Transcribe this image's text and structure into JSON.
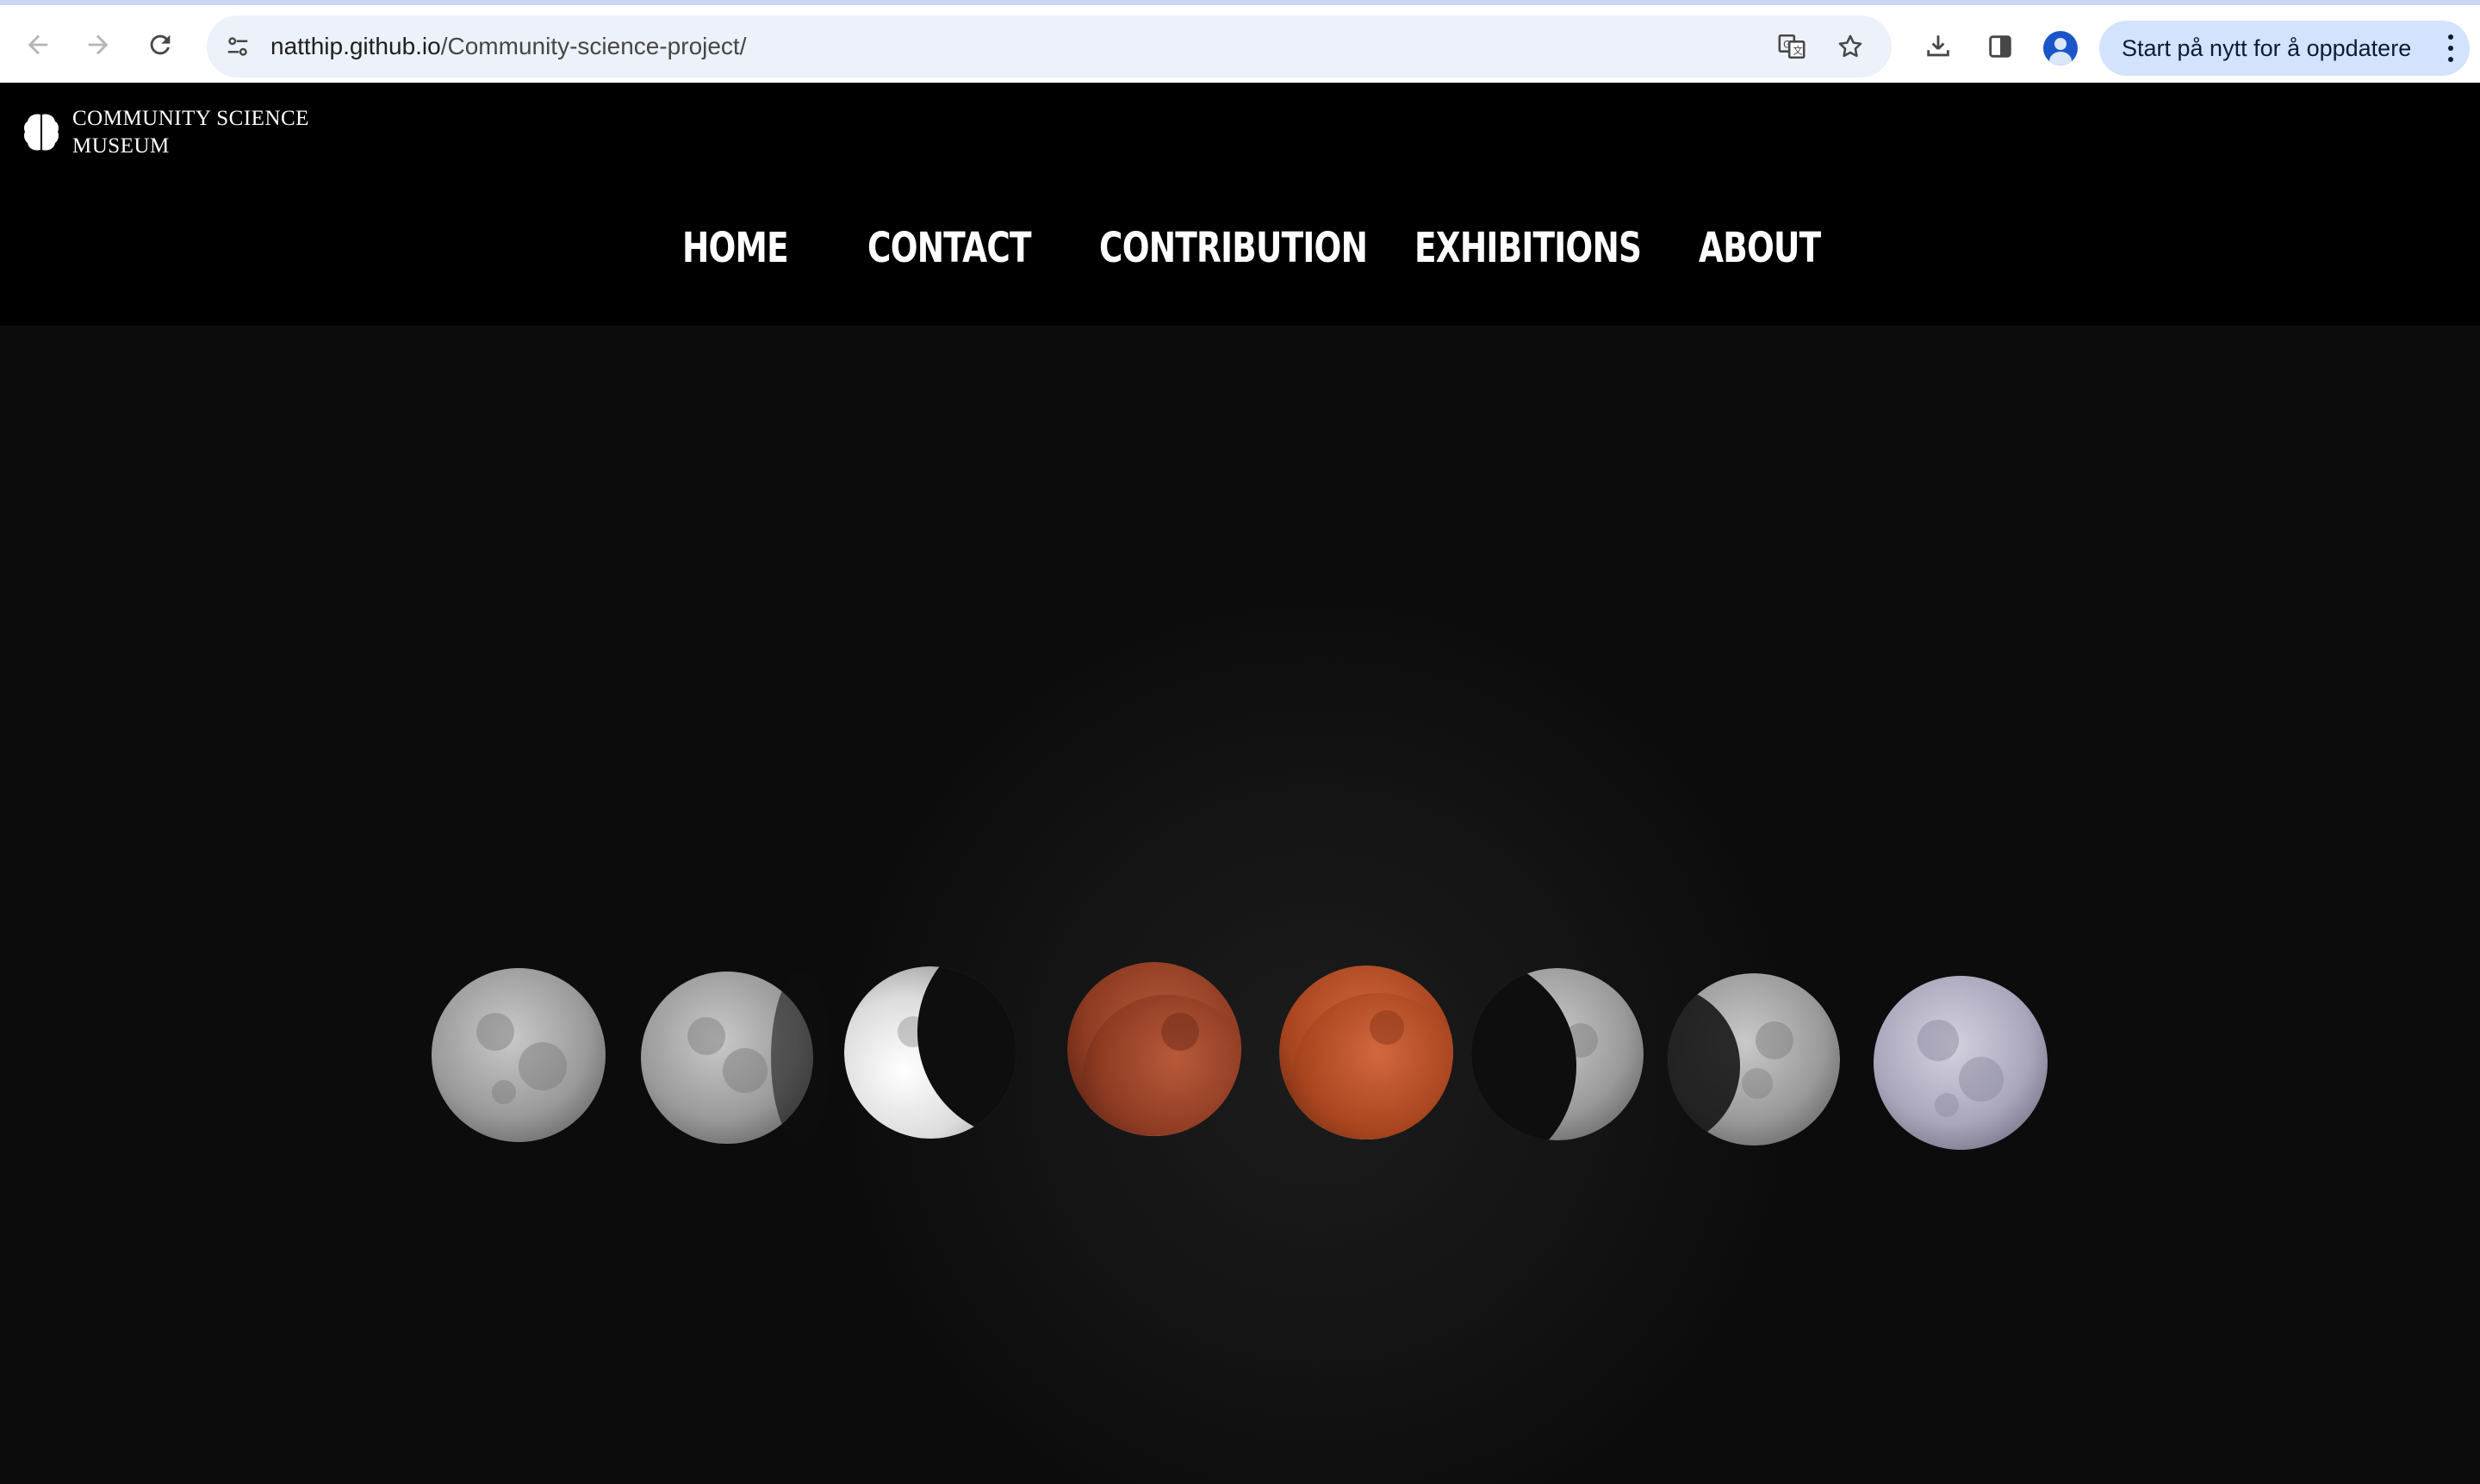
{
  "browser": {
    "url_host": "natthip.github.io",
    "url_path": "/Community-science-project/",
    "update_button_label": "Start på nytt for å oppdatere",
    "icons": [
      "back-icon",
      "forward-icon",
      "reload-icon",
      "site-info-icon",
      "translate-icon",
      "bookmark-star-icon",
      "download-icon",
      "side-panel-icon",
      "profile-avatar-icon",
      "more-menu-icon"
    ]
  },
  "site": {
    "logo_line1": "COMMUNITY SCIENCE",
    "logo_line2": "MUSEUM",
    "logo_icon": "brain-icon",
    "nav": [
      {
        "label": "HOME"
      },
      {
        "label": "CONTACT"
      },
      {
        "label": "CONTRIBUTION"
      },
      {
        "label": "EXHIBITIONS"
      },
      {
        "label": "ABOUT"
      }
    ]
  },
  "hero": {
    "image_subject": "lunar-eclipse-phases",
    "moon_phase_count": 8,
    "colors": {
      "background": "#0e0e0e",
      "moon_gray": "#a9a9a9",
      "blood_moon": "#a0442a",
      "bluish_moon": "#b3b0c2"
    }
  }
}
